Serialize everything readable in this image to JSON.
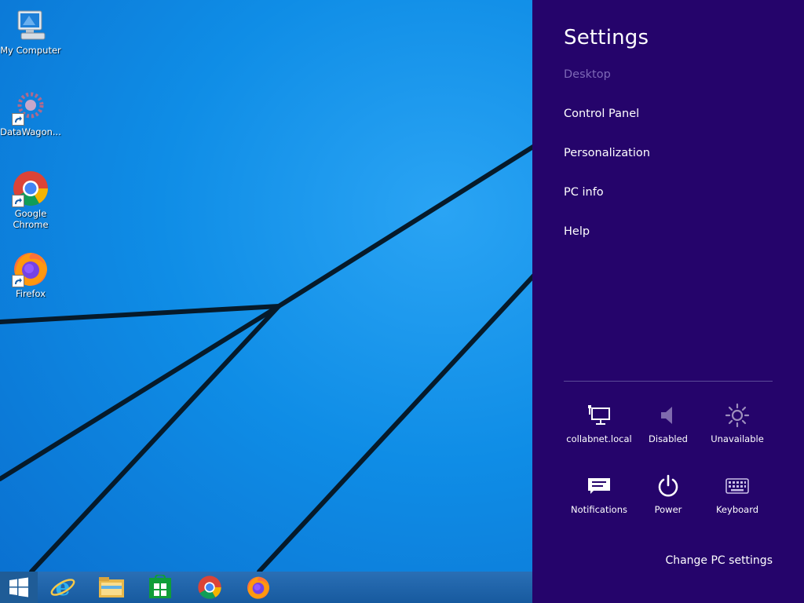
{
  "desktop": {
    "icons": [
      {
        "label": "My Computer",
        "icon": "computer-icon"
      },
      {
        "label": "DataWagon...",
        "icon": "datawagon-icon"
      },
      {
        "label": "Google Chrome",
        "icon": "chrome-icon"
      },
      {
        "label": "Firefox",
        "icon": "firefox-icon"
      }
    ]
  },
  "taskbar": {
    "items": [
      {
        "icon": "windows-start-icon"
      },
      {
        "icon": "internet-explorer-icon"
      },
      {
        "icon": "file-explorer-icon"
      },
      {
        "icon": "windows-store-icon"
      },
      {
        "icon": "chrome-icon"
      },
      {
        "icon": "firefox-icon"
      }
    ]
  },
  "settings": {
    "title": "Settings",
    "menu": [
      {
        "label": "Desktop",
        "enabled": false
      },
      {
        "label": "Control Panel",
        "enabled": true
      },
      {
        "label": "Personalization",
        "enabled": true
      },
      {
        "label": "PC info",
        "enabled": true
      },
      {
        "label": "Help",
        "enabled": true
      }
    ],
    "quick": [
      {
        "label": "collabnet.local",
        "icon": "network-icon"
      },
      {
        "label": "Disabled",
        "icon": "volume-icon"
      },
      {
        "label": "Unavailable",
        "icon": "brightness-icon"
      },
      {
        "label": "Notifications",
        "icon": "notifications-icon"
      },
      {
        "label": "Power",
        "icon": "power-icon"
      },
      {
        "label": "Keyboard",
        "icon": "keyboard-icon"
      }
    ],
    "change_label": "Change PC settings"
  },
  "colors": {
    "panel_bg": "#25046b",
    "desktop_blue": "#0f8de6",
    "taskbar": "#1a5fa8",
    "disabled_text": "#7d68b6"
  }
}
